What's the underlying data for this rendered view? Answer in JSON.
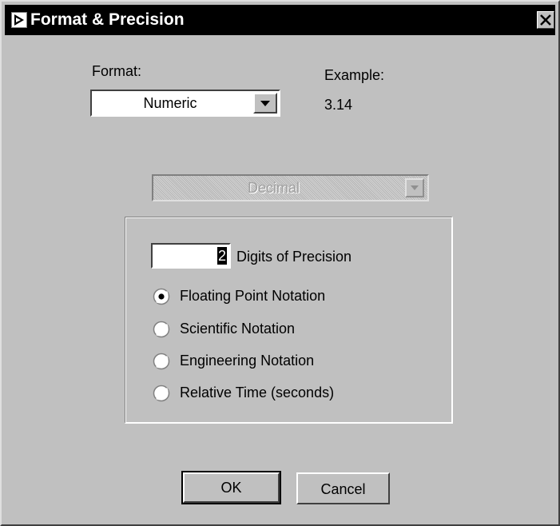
{
  "window": {
    "title": "Format & Precision",
    "icon": "labview-run-arrow-icon",
    "close_icon": "close-x-icon"
  },
  "format": {
    "label": "Format:",
    "selected": "Numeric"
  },
  "example": {
    "label": "Example:",
    "value": "3.14"
  },
  "base_select": {
    "selected": "Decimal",
    "enabled": false
  },
  "precision": {
    "digits": "2",
    "label": "Digits of Precision"
  },
  "notation": {
    "options": [
      {
        "label": "Floating Point Notation",
        "selected": true
      },
      {
        "label": "Scientific Notation",
        "selected": false
      },
      {
        "label": "Engineering Notation",
        "selected": false
      },
      {
        "label": "Relative Time (seconds)",
        "selected": false
      }
    ]
  },
  "buttons": {
    "ok": "OK",
    "cancel": "Cancel"
  },
  "colors": {
    "dialog_bg": "#c0c0c0",
    "titlebar_bg": "#000000",
    "titlebar_text": "#ffffff"
  }
}
